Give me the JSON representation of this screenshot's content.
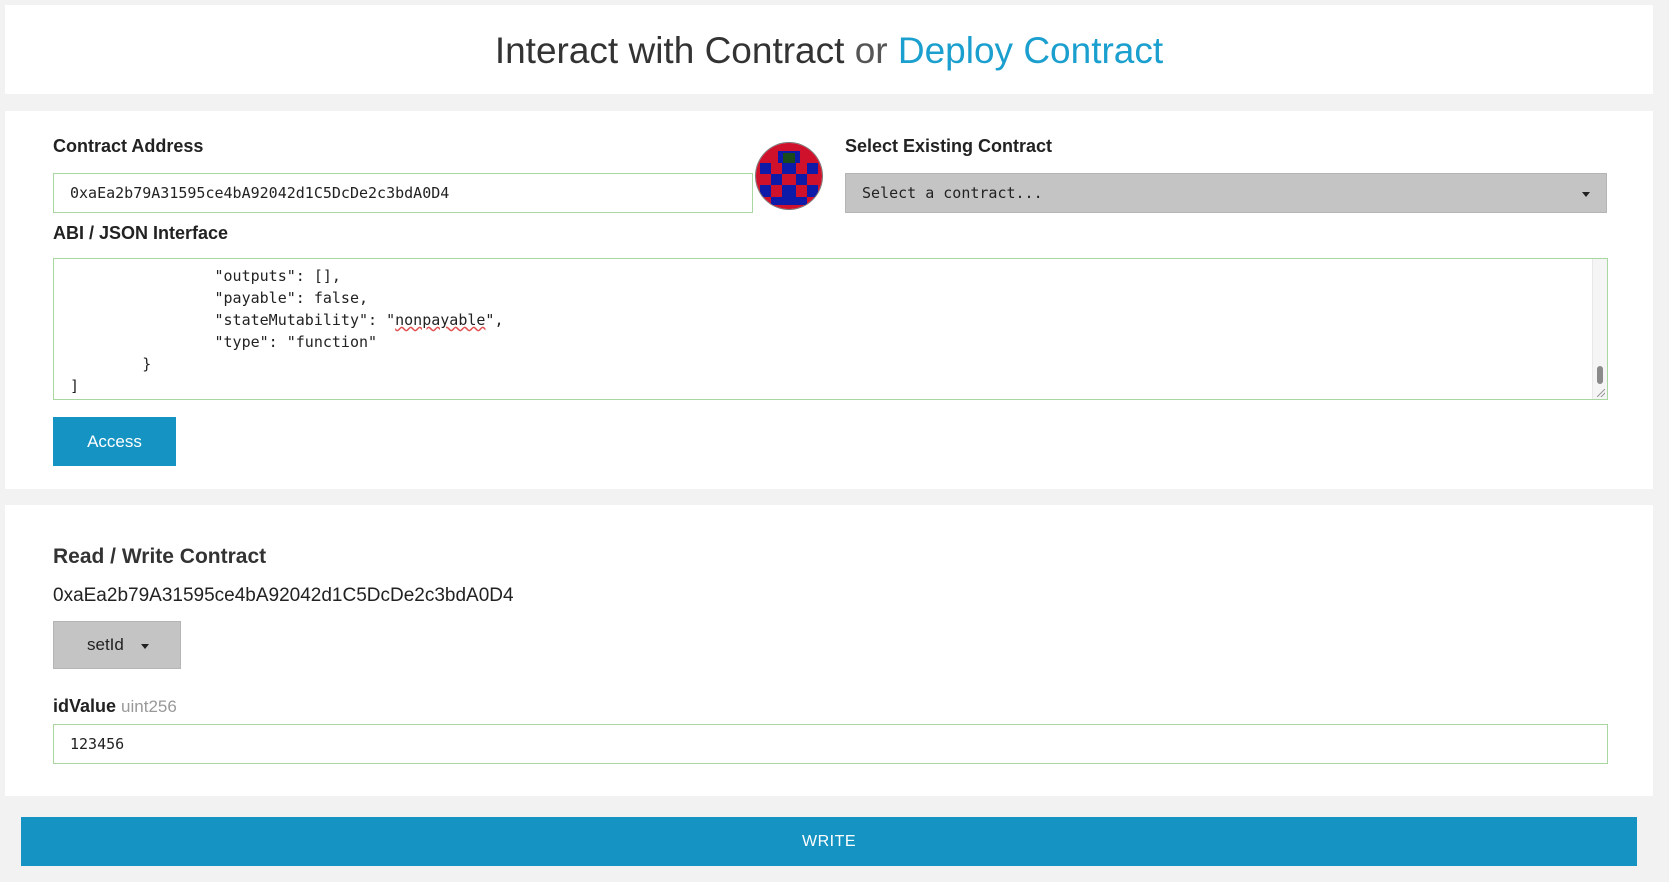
{
  "header": {
    "title_main": "Interact with Contract",
    "title_or": "or",
    "title_link": "Deploy Contract"
  },
  "access": {
    "address_label": "Contract Address",
    "address_value": "0xaEa2b79A31595ce4bA92042d1C5DcDe2c3bdA0D4",
    "select_label": "Select Existing Contract",
    "select_value": "Select a contract...",
    "abi_label": "ABI / JSON Interface",
    "abi_lines": [
      "                \"outputs\": [],",
      "                \"payable\": false,",
      "                \"stateMutability\": \"nonpayable\",",
      "                \"type\": \"function\"",
      "        }",
      "]"
    ],
    "access_button": "Access"
  },
  "read_write": {
    "title": "Read / Write Contract",
    "address": "0xaEa2b79A31595ce4bA92042d1C5DcDe2c3bdA0D4",
    "function_selected": "setId",
    "param_name": "idValue",
    "param_type": "uint256",
    "param_value": "123456"
  },
  "write_button": "WRITE",
  "colors": {
    "accent": "#1593c3",
    "link": "#1a9fce",
    "input_border": "#a8d8a0",
    "dropdown_bg": "#c4c4c4"
  },
  "icons": {
    "identicon": "identicon-avatar",
    "dropdown": "chevron-down-icon"
  }
}
